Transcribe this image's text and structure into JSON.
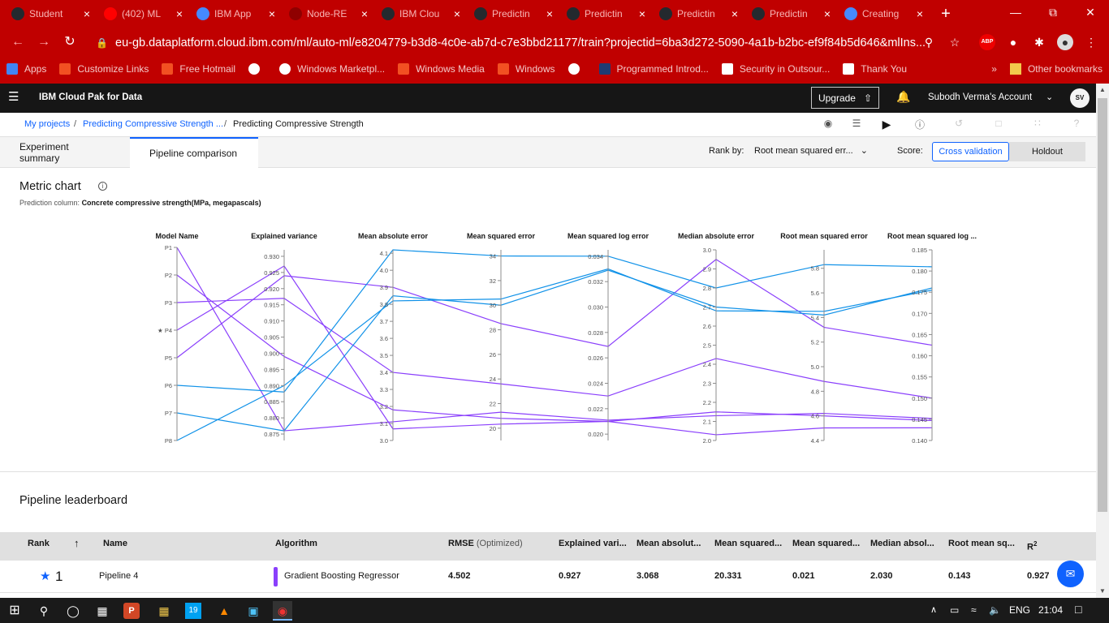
{
  "browser": {
    "tabs": [
      {
        "title": "Student",
        "favicon": "github-icon",
        "color": "#24292e"
      },
      {
        "title": "(402) ML",
        "favicon": "youtube-icon",
        "color": "#ff0000"
      },
      {
        "title": "IBM App",
        "favicon": "ibm-cloud-icon",
        "color": "#4589ff"
      },
      {
        "title": "Node-RE",
        "favicon": "node-red-icon",
        "color": "#8f0000"
      },
      {
        "title": "IBM Clou",
        "favicon": "github-icon",
        "color": "#24292e"
      },
      {
        "title": "Predictin",
        "favicon": "github-icon",
        "color": "#24292e"
      },
      {
        "title": "Predictin",
        "favicon": "github-icon",
        "color": "#24292e"
      },
      {
        "title": "Predictin",
        "favicon": "github-icon",
        "color": "#24292e"
      },
      {
        "title": "Predictin",
        "favicon": "github-icon",
        "color": "#24292e"
      },
      {
        "title": "Creating",
        "favicon": "ibm-cloud-icon",
        "color": "#4589ff"
      }
    ],
    "url": "eu-gb.dataplatform.cloud.ibm.com/ml/auto-ml/e8204779-b3d8-4c0e-ab7d-c7e3bbd21177/train?projectid=6ba3d272-5090-4a1b-b2bc-ef9f84b5d646&mlIns...",
    "bookmarks": [
      {
        "label": "Apps",
        "icon": "apps-grid-icon"
      },
      {
        "label": "Customize Links",
        "icon": "windows-icon"
      },
      {
        "label": "Free Hotmail",
        "icon": "windows-icon"
      },
      {
        "label": "",
        "icon": "globe-icon"
      },
      {
        "label": "Windows Marketpl...",
        "icon": "globe-icon"
      },
      {
        "label": "Windows Media",
        "icon": "windows-icon"
      },
      {
        "label": "Windows",
        "icon": "windows-icon"
      },
      {
        "label": "",
        "icon": "globe-icon"
      },
      {
        "label": "Programmed Introd...",
        "icon": "next-icon"
      },
      {
        "label": "Security in Outsour...",
        "icon": "page-icon"
      },
      {
        "label": "Thank You",
        "icon": "amazon-icon"
      }
    ],
    "other_bookmarks": "Other bookmarks",
    "overflow": "»"
  },
  "header": {
    "product": "IBM Cloud Pak for Data",
    "upgrade": "Upgrade",
    "account": "Subodh Verma's Account",
    "avatar": "SV"
  },
  "breadcrumb": {
    "root": "My projects",
    "project": "Predicting Compressive Strength ...",
    "current": "Predicting Compressive Strength"
  },
  "tabs": {
    "summary": "Experiment summary",
    "comparison": "Pipeline comparison"
  },
  "controls": {
    "rank_by_label": "Rank by:",
    "rank_by_value": "Root mean squared err...",
    "score_label": "Score:",
    "cross_validation": "Cross validation",
    "holdout": "Holdout"
  },
  "metric": {
    "title": "Metric chart",
    "prediction_label": "Prediction column:",
    "prediction_value": "Concrete compressive strength(MPa, megapascals)"
  },
  "chart_data": {
    "type": "parallel-coordinates",
    "axes": [
      {
        "name": "Model Name",
        "categories": [
          "P1",
          "P2",
          "P3",
          "★ P4",
          "P5",
          "P6",
          "P7",
          "P8"
        ]
      },
      {
        "name": "Explained variance",
        "min": 0.873,
        "max": 0.932,
        "ticks": [
          0.875,
          0.88,
          0.885,
          0.89,
          0.895,
          0.9,
          0.905,
          0.91,
          0.915,
          0.92,
          0.925,
          0.93
        ],
        "decimals": 3
      },
      {
        "name": "Mean absolute error",
        "min": 3.0,
        "max": 4.12,
        "ticks": [
          3.0,
          3.1,
          3.2,
          3.3,
          3.4,
          3.5,
          3.6,
          3.7,
          3.8,
          3.9,
          4.0,
          4.1
        ],
        "decimals": 1
      },
      {
        "name": "Mean squared error",
        "min": 19,
        "max": 34.5,
        "ticks": [
          20,
          22,
          24,
          26,
          28,
          30,
          32,
          34
        ],
        "decimals": 0
      },
      {
        "name": "Mean squared log error",
        "min": 0.0195,
        "max": 0.0345,
        "ticks": [
          0.02,
          0.022,
          0.024,
          0.026,
          0.028,
          0.03,
          0.032,
          0.034
        ],
        "decimals": 3
      },
      {
        "name": "Median absolute error",
        "min": 2.0,
        "max": 3.0,
        "ticks": [
          2.0,
          2.1,
          2.2,
          2.3,
          2.4,
          2.5,
          2.6,
          2.7,
          2.8,
          2.9,
          3.0
        ],
        "decimals": 1
      },
      {
        "name": "Root mean squared error",
        "min": 4.4,
        "max": 5.95,
        "ticks": [
          4.4,
          4.6,
          4.8,
          5.0,
          5.2,
          5.4,
          5.6,
          5.8
        ],
        "decimals": 1
      },
      {
        "name": "Root mean squared log ...",
        "min": 0.14,
        "max": 0.185,
        "ticks": [
          0.14,
          0.145,
          0.15,
          0.155,
          0.16,
          0.165,
          0.17,
          0.175,
          0.18,
          0.185
        ],
        "decimals": 3
      }
    ],
    "pipelines": [
      {
        "name": "P1",
        "color": "#8a3ffc",
        "values": [
          0.876,
          3.11,
          21.3,
          0.0211,
          2.13,
          4.62,
          0.1452
        ]
      },
      {
        "name": "P2",
        "color": "#8a3ffc",
        "values": [
          0.899,
          3.18,
          20.8,
          0.021,
          2.15,
          4.6,
          0.1447
        ]
      },
      {
        "name": "P3",
        "color": "#8a3ffc",
        "values": [
          0.917,
          3.4,
          23.6,
          0.023,
          2.43,
          4.88,
          0.15
        ]
      },
      {
        "name": "P4",
        "color": "#8a3ffc",
        "values": [
          0.927,
          3.068,
          20.331,
          0.021,
          2.03,
          4.502,
          0.143
        ]
      },
      {
        "name": "P5",
        "color": "#8a3ffc",
        "values": [
          0.924,
          3.9,
          28.5,
          0.0269,
          2.95,
          5.32,
          0.1625
        ]
      },
      {
        "name": "P6",
        "color": "#1192e8",
        "values": [
          0.888,
          4.12,
          34.0,
          0.034,
          2.8,
          5.83,
          0.181
        ]
      },
      {
        "name": "P7",
        "color": "#1192e8",
        "values": [
          0.876,
          3.85,
          30.0,
          0.0329,
          2.7,
          5.42,
          0.176
        ]
      },
      {
        "name": "P8",
        "color": "#1192e8",
        "values": [
          0.89,
          3.82,
          30.5,
          0.033,
          2.68,
          5.45,
          0.1755
        ]
      }
    ]
  },
  "leaderboard": {
    "title": "Pipeline leaderboard",
    "columns": {
      "rank": "Rank",
      "sort": "↑",
      "name": "Name",
      "algorithm": "Algorithm",
      "rmse": "RMSE",
      "rmse_sub": "(Optimized)",
      "explained": "Explained vari...",
      "mae": "Mean absolut...",
      "mse": "Mean squared...",
      "msle": "Mean squared...",
      "medae": "Median absol...",
      "rmsle": "Root mean sq...",
      "r2": "R"
    },
    "rows": [
      {
        "rank": "1",
        "name": "Pipeline 4",
        "algorithm": "Gradient Boosting Regressor",
        "rmse": "4.502",
        "explained": "0.927",
        "mae": "3.068",
        "mse": "20.331",
        "msle": "0.021",
        "medae": "2.030",
        "rmsle": "0.143",
        "r2": "0.927"
      }
    ]
  },
  "taskbar": {
    "lang": "ENG",
    "time": "21:04"
  }
}
